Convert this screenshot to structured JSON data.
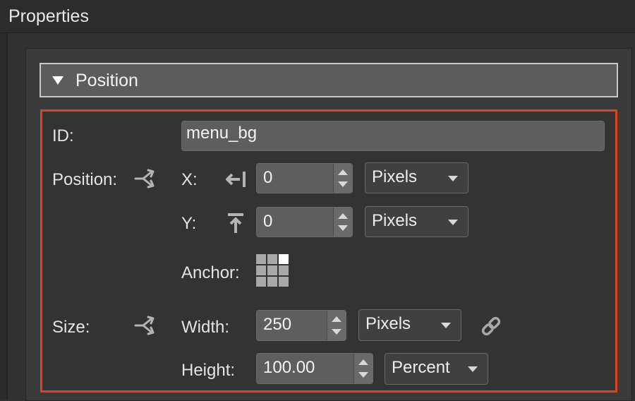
{
  "panel": {
    "title": "Properties"
  },
  "section": {
    "title": "Position",
    "expanded": true
  },
  "fields": {
    "id_label": "ID:",
    "id_value": "menu_bg",
    "position_label": "Position:",
    "x_label": "X:",
    "x_value": "0",
    "x_unit": "Pixels",
    "y_label": "Y:",
    "y_value": "0",
    "y_unit": "Pixels",
    "anchor_label": "Anchor:",
    "anchor_selected": "top-right",
    "size_label": "Size:",
    "width_label": "Width:",
    "width_value": "250",
    "width_unit": "Pixels",
    "height_label": "Height:",
    "height_value": "100.00",
    "height_unit": "Percent"
  },
  "icons": {
    "section_toggle": "triangle-down-icon",
    "position_mode": "split-arrow-icon",
    "x_align": "align-left-icon",
    "y_align": "align-top-icon",
    "anchor": "anchor-grid-icon",
    "size_mode": "split-arrow-icon",
    "link": "chain-link-icon"
  },
  "colors": {
    "highlight_border": "#e0421f",
    "background": "#323232",
    "section_header": "#5c5c5c"
  }
}
